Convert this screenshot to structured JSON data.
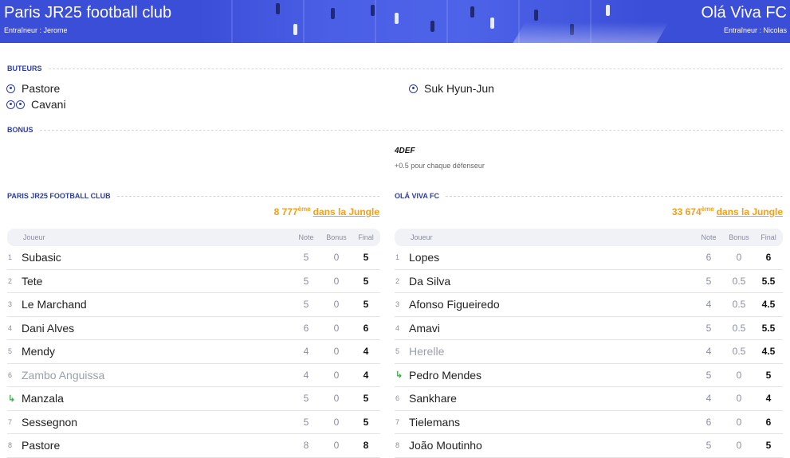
{
  "header": {
    "home_team": "Paris JR25 football club",
    "home_coach": "Entraîneur : Jerome",
    "away_team": "Olá Viva FC",
    "away_coach": "Entraîneur : Nicolas"
  },
  "sections": {
    "scorers_title": "BUTEURS",
    "bonus_title": "BONUS"
  },
  "scorers": {
    "home": [
      {
        "name": "Pastore",
        "goals": 1
      },
      {
        "name": "Cavani",
        "goals": 2
      }
    ],
    "away": [
      {
        "name": "Suk Hyun-Jun",
        "goals": 1
      }
    ]
  },
  "bonus": {
    "name": "4DEF",
    "description": "+0.5 pour chaque défenseur"
  },
  "colors": {
    "accent": "#2e3d9e",
    "banner": "#3b4ed8",
    "rank": "#f0a11c",
    "sub_arrow": "#3fb34a"
  },
  "home_table": {
    "title": "PARIS JR25 FOOTBALL CLUB",
    "rank_value": "8 777",
    "rank_suffix": "ème",
    "rank_link": "dans la Jungle",
    "headers": {
      "player": "Joueur",
      "note": "Note",
      "bonus": "Bonus",
      "final": "Final"
    },
    "rows": [
      {
        "num": "1",
        "name": "Subasic",
        "note": "5",
        "bonus": "0",
        "final": "5",
        "sub": false
      },
      {
        "num": "2",
        "name": "Tete",
        "note": "5",
        "bonus": "0",
        "final": "5",
        "sub": false
      },
      {
        "num": "3",
        "name": "Le Marchand",
        "note": "5",
        "bonus": "0",
        "final": "5",
        "sub": false
      },
      {
        "num": "4",
        "name": "Dani Alves",
        "note": "6",
        "bonus": "0",
        "final": "6",
        "sub": false
      },
      {
        "num": "5",
        "name": "Mendy",
        "note": "4",
        "bonus": "0",
        "final": "4",
        "sub": false
      },
      {
        "num": "6",
        "name": "Zambo Anguissa",
        "note": "4",
        "bonus": "0",
        "final": "4",
        "sub": true
      },
      {
        "num": "↳",
        "name": "Manzala",
        "note": "5",
        "bonus": "0",
        "final": "5",
        "sub": false,
        "sub_in": true
      },
      {
        "num": "7",
        "name": "Sessegnon",
        "note": "5",
        "bonus": "0",
        "final": "5",
        "sub": false
      },
      {
        "num": "8",
        "name": "Pastore",
        "note": "8",
        "bonus": "0",
        "final": "8",
        "sub": false
      }
    ]
  },
  "away_table": {
    "title": "OLÁ VIVA FC",
    "rank_value": "33 674",
    "rank_suffix": "ème",
    "rank_link": "dans la Jungle",
    "headers": {
      "player": "Joueur",
      "note": "Note",
      "bonus": "Bonus",
      "final": "Final"
    },
    "rows": [
      {
        "num": "1",
        "name": "Lopes",
        "note": "6",
        "bonus": "0",
        "final": "6",
        "sub": false
      },
      {
        "num": "2",
        "name": "Da Silva",
        "note": "5",
        "bonus": "0.5",
        "final": "5.5",
        "sub": false
      },
      {
        "num": "3",
        "name": "Afonso Figueiredo",
        "note": "4",
        "bonus": "0.5",
        "final": "4.5",
        "sub": false
      },
      {
        "num": "4",
        "name": "Amavi",
        "note": "5",
        "bonus": "0.5",
        "final": "5.5",
        "sub": false
      },
      {
        "num": "5",
        "name": "Herelle",
        "note": "4",
        "bonus": "0.5",
        "final": "4.5",
        "sub": true
      },
      {
        "num": "↳",
        "name": "Pedro Mendes",
        "note": "5",
        "bonus": "0",
        "final": "5",
        "sub": false,
        "sub_in": true
      },
      {
        "num": "6",
        "name": "Sankhare",
        "note": "4",
        "bonus": "0",
        "final": "4",
        "sub": false
      },
      {
        "num": "7",
        "name": "Tielemans",
        "note": "6",
        "bonus": "0",
        "final": "6",
        "sub": false
      },
      {
        "num": "8",
        "name": "João Moutinho",
        "note": "5",
        "bonus": "0",
        "final": "5",
        "sub": false
      }
    ]
  }
}
